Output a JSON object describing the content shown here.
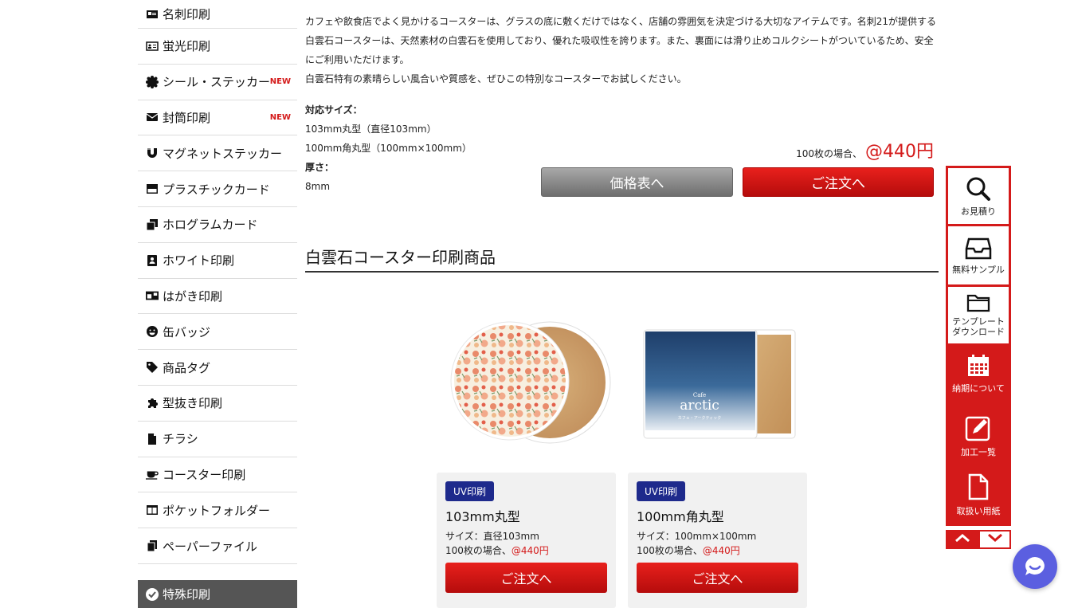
{
  "sidebar": {
    "items": [
      {
        "label": "名刺印刷",
        "icon": "business-card-icon",
        "new": ""
      },
      {
        "label": "蛍光印刷",
        "icon": "id-card-icon",
        "new": ""
      },
      {
        "label": "シール・ステッカー",
        "icon": "seal-icon",
        "new": "NEW"
      },
      {
        "label": "封筒印刷",
        "icon": "envelope-icon",
        "new": "NEW"
      },
      {
        "label": "マグネットステッカー",
        "icon": "magnet-icon",
        "new": ""
      },
      {
        "label": "プラスチックカード",
        "icon": "plastic-card-icon",
        "new": ""
      },
      {
        "label": "ホログラムカード",
        "icon": "hologram-card-icon",
        "new": ""
      },
      {
        "label": "ホワイト印刷",
        "icon": "contact-card-icon",
        "new": ""
      },
      {
        "label": "はがき印刷",
        "icon": "postcard-icon",
        "new": ""
      },
      {
        "label": "缶バッジ",
        "icon": "smile-icon",
        "new": ""
      },
      {
        "label": "商品タグ",
        "icon": "tag-icon",
        "new": ""
      },
      {
        "label": "型抜き印刷",
        "icon": "puzzle-icon",
        "new": ""
      },
      {
        "label": "チラシ",
        "icon": "document-icon",
        "new": ""
      },
      {
        "label": "コースター印刷",
        "icon": "coffee-icon",
        "new": ""
      },
      {
        "label": "ポケットフォルダー",
        "icon": "folder-table-icon",
        "new": ""
      },
      {
        "label": "ペーパーファイル",
        "icon": "copy-icon",
        "new": ""
      }
    ],
    "section": "特殊印刷"
  },
  "description": {
    "p1": "カフェや飲食店でよく見かけるコースターは、グラスの底に敷くだけではなく、店舗の雰囲気を決定づける大切なアイテムです。名刺21が提供する",
    "p2": "白雲石コースターは、天然素材の白雲石を使用しており、優れた吸収性を誇ります。また、裏面には滑り止めコルクシートがついているため、安全",
    "p3": "にご利用いただけます。",
    "p4": "白雲石特有の素晴らしい風合いや質感を、ぜひこの特別なコースターでお試しください。"
  },
  "spec": {
    "size_label": "対応サイズ：",
    "size1": "103mm丸型（直径103mm）",
    "size2": "100mm角丸型（100mm×100mm）",
    "thickness_label": "厚さ：",
    "thickness": "8mm"
  },
  "price": {
    "prefix": "100枚の場合、",
    "amount": "@440円"
  },
  "buttons": {
    "price_table": "価格表へ",
    "order": "ご注文へ"
  },
  "section_title": "白雲石コースター印刷商品",
  "products": [
    {
      "badge": "UV印刷",
      "name": "103mm丸型",
      "size": "サイズ：直径103mm",
      "price_prefix": "100枚の場合、",
      "price": "@440円",
      "order": "ご注文へ"
    },
    {
      "badge": "UV印刷",
      "name": "100mm角丸型",
      "size": "サイズ：100mm×100mm",
      "price_prefix": "100枚の場合、",
      "price": "@440円",
      "order": "ご注文へ"
    }
  ],
  "product_image_text": {
    "small": "Cafe",
    "big": "arctic",
    "tag": "カフェ・アークティック"
  },
  "float_nav": {
    "estimate": "お見積り",
    "sample": "無料サンプル",
    "template": "テンプレート\nダウンロード",
    "delivery": "納期について",
    "processing": "加工一覧",
    "paper": "取扱い用紙"
  },
  "colors": {
    "accent": "#d41a1a",
    "badge": "#1e2a8c",
    "chat": "#5b5fe0"
  }
}
